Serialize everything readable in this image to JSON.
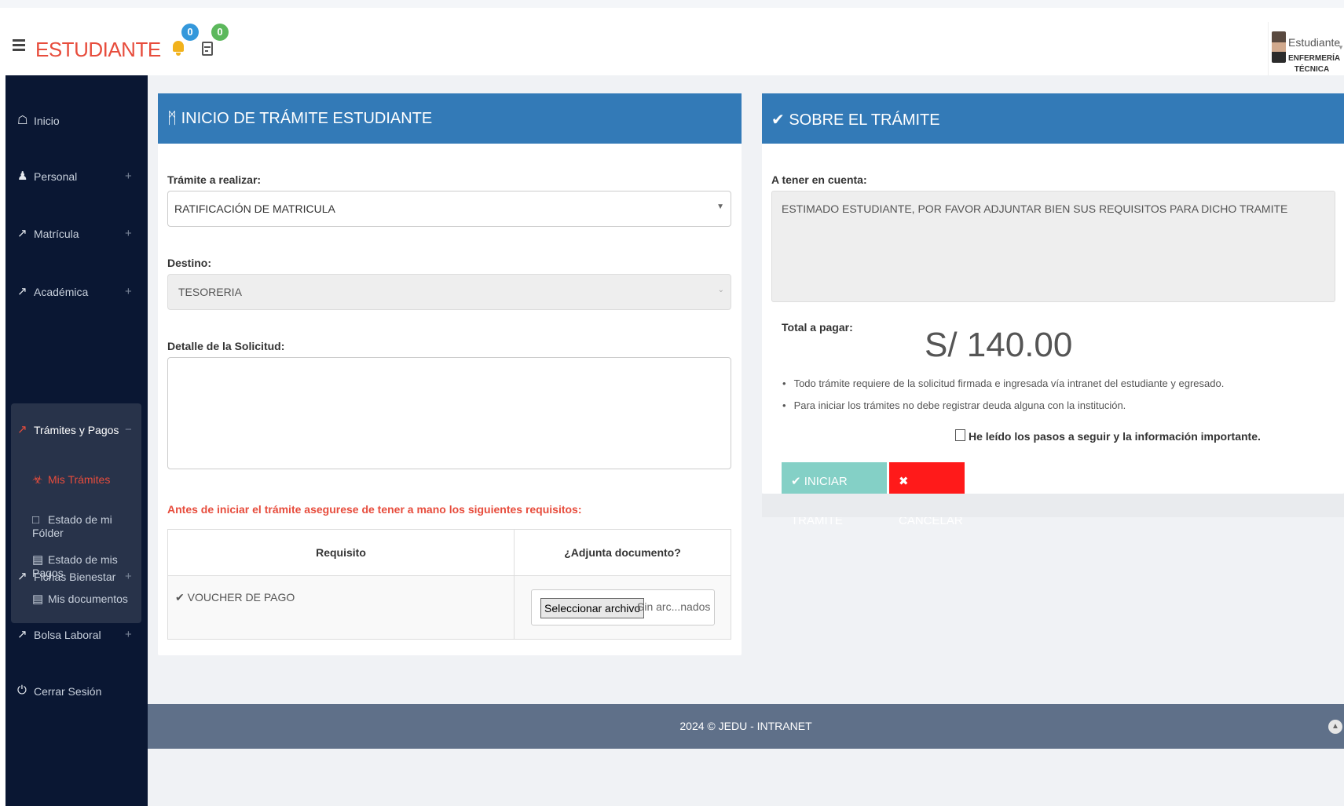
{
  "header": {
    "brand": "ESTUDIANTE",
    "notifications_count": "0",
    "payments_count": "0",
    "user_name": "Estudiante",
    "user_career": "ENFERMERÍA TÉCNICA"
  },
  "sidebar": {
    "items": [
      {
        "label": "Inicio",
        "icon": "home-icon"
      },
      {
        "label": "Personal",
        "icon": "user-icon",
        "expand": "+"
      },
      {
        "label": "Matrícula",
        "icon": "external-link-icon",
        "expand": "+"
      },
      {
        "label": "Académica",
        "icon": "external-link-icon",
        "expand": "+"
      },
      {
        "label": "Trámites y Pagos",
        "icon": "external-link-icon",
        "expand": "−"
      },
      {
        "label": "Fichas Bienestar",
        "icon": "external-link-icon",
        "expand": "+"
      },
      {
        "label": "Bolsa Laboral",
        "icon": "external-link-icon",
        "expand": "+"
      },
      {
        "label": "Cerrar Sesión",
        "icon": "power-icon"
      }
    ],
    "subitems": [
      {
        "label": "Mis Trámites",
        "icon": "sitemap-icon",
        "active": true
      },
      {
        "label": "Estado de mi Fólder",
        "icon": "folder-icon"
      },
      {
        "label": "Estado de mis Pagos",
        "icon": "credit-card-icon"
      },
      {
        "label": "Mis documentos",
        "icon": "file-icon"
      }
    ]
  },
  "left_panel": {
    "title": "INICIO DE TRÁMITE ESTUDIANTE",
    "tramite_label": "Trámite a realizar:",
    "tramite_value": "RATIFICACIÓN DE MATRICULA",
    "destino_label": "Destino:",
    "destino_value": "TESORERIA",
    "detalle_label": "Detalle de la Solicitud:",
    "requisitos_title": "Antes de iniciar el trámite asegurese de tener a mano los siguientes requisitos:",
    "table_headers": [
      "Requisito",
      "¿Adjunta documento?"
    ],
    "requisitos": [
      {
        "name": "VOUCHER DE PAGO",
        "file_button": "Seleccionar archivo",
        "file_status": "Sin arc...nados"
      }
    ]
  },
  "right_panel": {
    "title": "SOBRE EL TRÁMITE",
    "tener_label": "A tener en cuenta:",
    "note": "ESTIMADO ESTUDIANTE, POR FAVOR ADJUNTAR BIEN SUS REQUISITOS PARA DICHO TRAMITE",
    "total_label": "Total a pagar:",
    "total_value": "S/ 140.00",
    "bullets": [
      "Todo trámite requiere de la solicitud firmada e ingresada vía intranet del estudiante y egresado.",
      "Para iniciar los trámites no debe registrar deuda alguna con la institución."
    ],
    "checkbox_label": "He leído los pasos a seguir y la información importante.",
    "start_button": "INICIAR TRÁMITE",
    "cancel_button": "CANCELAR"
  },
  "footer": {
    "text": "2024 © JEDU - INTRANET"
  },
  "colors": {
    "brand": "#e74c3c",
    "panel_header": "#337ab7",
    "sidebar": "#0a1733",
    "start_button": "#84d0c6",
    "cancel_button": "#ff1a1a"
  }
}
